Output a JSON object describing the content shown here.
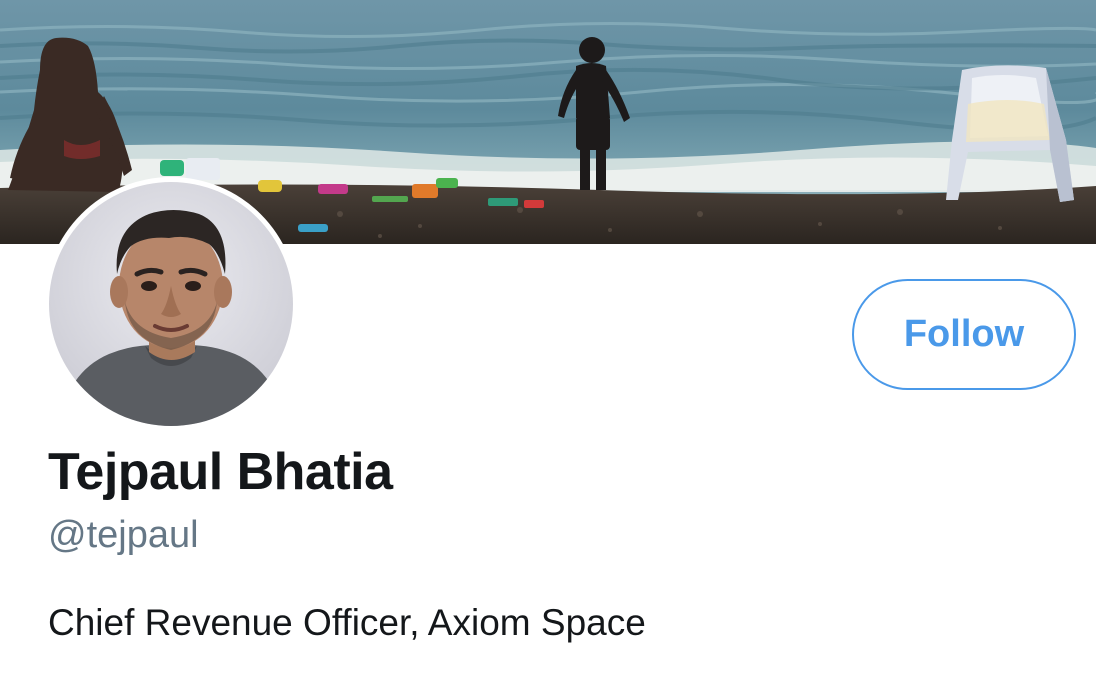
{
  "banner": {
    "image": "beach-scene-banner"
  },
  "profile": {
    "avatar": "profile-photo",
    "display_name": "Tejpaul Bhatia",
    "handle": "@tejpaul",
    "bio": "Chief Revenue Officer, Axiom Space"
  },
  "actions": {
    "follow_label": "Follow"
  },
  "colors": {
    "accent": "#4a99e9",
    "name_text": "#14171a",
    "handle_text": "#657786"
  }
}
